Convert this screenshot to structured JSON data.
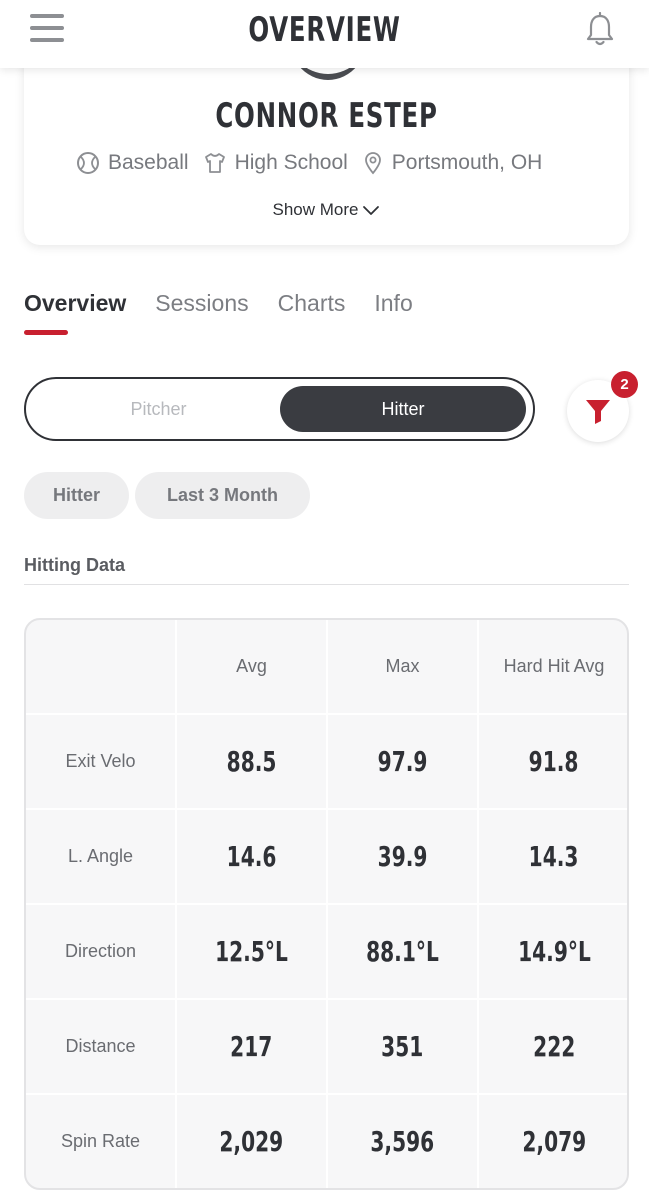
{
  "header": {
    "title": "OVERVIEW",
    "menu_icon": "hamburger-menu-icon",
    "notification_icon": "bell-icon"
  },
  "profile": {
    "name": "CONNOR ESTEP",
    "sport": "Baseball",
    "level": "High School",
    "location": "Portsmouth, OH",
    "show_more_label": "Show More"
  },
  "tabs": [
    {
      "label": "Overview",
      "active": true
    },
    {
      "label": "Sessions",
      "active": false
    },
    {
      "label": "Charts",
      "active": false
    },
    {
      "label": "Info",
      "active": false
    }
  ],
  "role_toggle": {
    "options": [
      "Pitcher",
      "Hitter"
    ],
    "selected": "Hitter"
  },
  "filter": {
    "icon": "funnel-icon",
    "badge_count": "2"
  },
  "filter_chips": [
    "Hitter",
    "Last 3 Month"
  ],
  "hitting_data": {
    "title": "Hitting Data",
    "columns": [
      "",
      "Avg",
      "Max",
      "Hard Hit Avg"
    ],
    "rows": [
      {
        "label": "Exit Velo",
        "values": [
          "88.5",
          "97.9",
          "91.8"
        ]
      },
      {
        "label": "L. Angle",
        "values": [
          "14.6",
          "39.9",
          "14.3"
        ]
      },
      {
        "label": "Direction",
        "values": [
          "12.5°L",
          "88.1°L",
          "14.9°L"
        ]
      },
      {
        "label": "Distance",
        "values": [
          "217",
          "351",
          "222"
        ]
      },
      {
        "label": "Spin Rate",
        "values": [
          "2,029",
          "3,596",
          "2,079"
        ]
      }
    ]
  },
  "colors": {
    "accent": "#c8202f",
    "dark": "#3a3c41",
    "table_bg": "#f7f7f8"
  }
}
